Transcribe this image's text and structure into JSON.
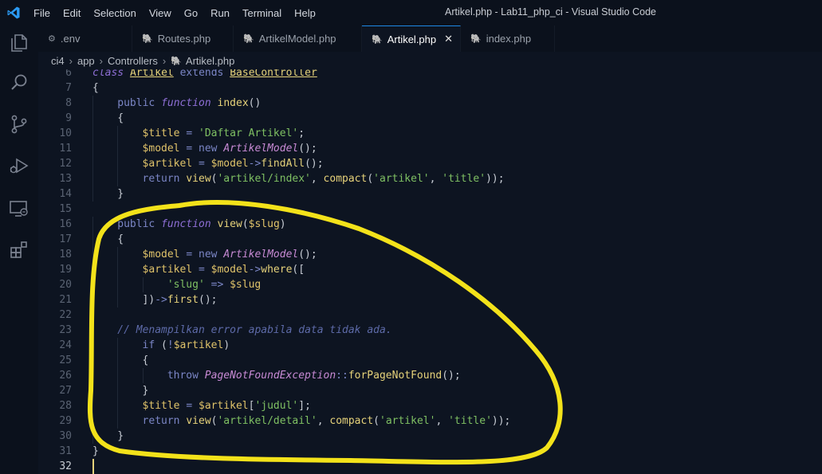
{
  "titlebar": {
    "menu": [
      "File",
      "Edit",
      "Selection",
      "View",
      "Go",
      "Run",
      "Terminal",
      "Help"
    ],
    "window_title": "Artikel.php - Lab11_php_ci - Visual Studio Code"
  },
  "activity_icons": [
    "explorer-icon",
    "search-icon",
    "source-control-icon",
    "run-debug-icon",
    "remote-explorer-icon",
    "extensions-icon"
  ],
  "tabs": [
    {
      "label": ".env",
      "icon": "gear-icon"
    },
    {
      "label": "Routes.php",
      "icon": "php-icon"
    },
    {
      "label": "ArtikelModel.php",
      "icon": "php-icon"
    },
    {
      "label": "Artikel.php",
      "icon": "php-icon",
      "active": true
    },
    {
      "label": "index.php",
      "icon": "php-icon"
    }
  ],
  "breadcrumb": [
    "ci4",
    "app",
    "Controllers",
    "Artikel.php"
  ],
  "editor": {
    "current_line": 32,
    "lines": [
      {
        "n": "6",
        "indent": 0,
        "t": [
          [
            "kf",
            "class"
          ],
          [
            "p",
            " "
          ],
          [
            "cls",
            "Artikel"
          ],
          [
            "p",
            " "
          ],
          [
            "op",
            "extends"
          ],
          [
            "p",
            " "
          ],
          [
            "cls",
            "BaseController"
          ]
        ]
      },
      {
        "n": "7",
        "indent": 0,
        "t": [
          [
            "p",
            "{"
          ]
        ]
      },
      {
        "n": "8",
        "indent": 1,
        "t": [
          [
            "k",
            "public"
          ],
          [
            "p",
            " "
          ],
          [
            "kf",
            "function"
          ],
          [
            "p",
            " "
          ],
          [
            "fn",
            "index"
          ],
          [
            "p",
            "()"
          ]
        ]
      },
      {
        "n": "9",
        "indent": 1,
        "t": [
          [
            "p",
            "{"
          ]
        ]
      },
      {
        "n": "10",
        "indent": 2,
        "t": [
          [
            "var",
            "$title"
          ],
          [
            "p",
            " "
          ],
          [
            "op",
            "="
          ],
          [
            "p",
            " "
          ],
          [
            "str",
            "'Daftar Artikel'"
          ],
          [
            "p",
            ";"
          ]
        ]
      },
      {
        "n": "11",
        "indent": 2,
        "t": [
          [
            "var",
            "$model"
          ],
          [
            "p",
            " "
          ],
          [
            "op",
            "="
          ],
          [
            "p",
            " "
          ],
          [
            "op",
            "new"
          ],
          [
            "p",
            " "
          ],
          [
            "cli",
            "ArtikelModel"
          ],
          [
            "p",
            "();"
          ]
        ]
      },
      {
        "n": "12",
        "indent": 2,
        "t": [
          [
            "var",
            "$artikel"
          ],
          [
            "p",
            " "
          ],
          [
            "op",
            "="
          ],
          [
            "p",
            " "
          ],
          [
            "var",
            "$model"
          ],
          [
            "op",
            "->"
          ],
          [
            "fn",
            "findAll"
          ],
          [
            "p",
            "();"
          ]
        ]
      },
      {
        "n": "13",
        "indent": 2,
        "t": [
          [
            "k",
            "return"
          ],
          [
            "p",
            " "
          ],
          [
            "fn",
            "view"
          ],
          [
            "p",
            "("
          ],
          [
            "str",
            "'artikel/index'"
          ],
          [
            "p",
            ", "
          ],
          [
            "fn",
            "compact"
          ],
          [
            "p",
            "("
          ],
          [
            "str",
            "'artikel'"
          ],
          [
            "p",
            ", "
          ],
          [
            "str",
            "'title'"
          ],
          [
            "p",
            "));"
          ]
        ]
      },
      {
        "n": "14",
        "indent": 1,
        "t": [
          [
            "p",
            "}"
          ]
        ]
      },
      {
        "n": "15",
        "indent": 0,
        "t": []
      },
      {
        "n": "16",
        "indent": 1,
        "t": [
          [
            "k",
            "public"
          ],
          [
            "p",
            " "
          ],
          [
            "kf",
            "function"
          ],
          [
            "p",
            " "
          ],
          [
            "fn",
            "view"
          ],
          [
            "p",
            "("
          ],
          [
            "var",
            "$slug"
          ],
          [
            "p",
            ")"
          ]
        ]
      },
      {
        "n": "17",
        "indent": 1,
        "t": [
          [
            "p",
            "{"
          ]
        ]
      },
      {
        "n": "18",
        "indent": 2,
        "t": [
          [
            "var",
            "$model"
          ],
          [
            "p",
            " "
          ],
          [
            "op",
            "="
          ],
          [
            "p",
            " "
          ],
          [
            "op",
            "new"
          ],
          [
            "p",
            " "
          ],
          [
            "cli",
            "ArtikelModel"
          ],
          [
            "p",
            "();"
          ]
        ]
      },
      {
        "n": "19",
        "indent": 2,
        "t": [
          [
            "var",
            "$artikel"
          ],
          [
            "p",
            " "
          ],
          [
            "op",
            "="
          ],
          [
            "p",
            " "
          ],
          [
            "var",
            "$model"
          ],
          [
            "op",
            "->"
          ],
          [
            "fn",
            "where"
          ],
          [
            "p",
            "(["
          ]
        ]
      },
      {
        "n": "20",
        "indent": 3,
        "t": [
          [
            "str",
            "'slug'"
          ],
          [
            "p",
            " "
          ],
          [
            "op",
            "=>"
          ],
          [
            "p",
            " "
          ],
          [
            "var",
            "$slug"
          ]
        ]
      },
      {
        "n": "21",
        "indent": 2,
        "t": [
          [
            "p",
            "])"
          ],
          [
            "op",
            "->"
          ],
          [
            "fn",
            "first"
          ],
          [
            "p",
            "();"
          ]
        ]
      },
      {
        "n": "22",
        "indent": 0,
        "t": []
      },
      {
        "n": "23",
        "indent": 1,
        "t": [
          [
            "cm",
            "// Menampilkan error apabila data tidak ada."
          ]
        ]
      },
      {
        "n": "24",
        "indent": 2,
        "t": [
          [
            "k",
            "if"
          ],
          [
            "p",
            " ("
          ],
          [
            "op",
            "!"
          ],
          [
            "var",
            "$artikel"
          ],
          [
            "p",
            ")"
          ]
        ]
      },
      {
        "n": "25",
        "indent": 2,
        "t": [
          [
            "p",
            "{"
          ]
        ]
      },
      {
        "n": "26",
        "indent": 3,
        "t": [
          [
            "k",
            "throw"
          ],
          [
            "p",
            " "
          ],
          [
            "cli",
            "PageNotFoundException"
          ],
          [
            "op",
            "::"
          ],
          [
            "fn",
            "forPageNotFound"
          ],
          [
            "p",
            "();"
          ]
        ]
      },
      {
        "n": "27",
        "indent": 2,
        "t": [
          [
            "p",
            "}"
          ]
        ]
      },
      {
        "n": "28",
        "indent": 2,
        "t": [
          [
            "var",
            "$title"
          ],
          [
            "p",
            " "
          ],
          [
            "op",
            "="
          ],
          [
            "p",
            " "
          ],
          [
            "var",
            "$artikel"
          ],
          [
            "p",
            "["
          ],
          [
            "str",
            "'judul'"
          ],
          [
            "p",
            "];"
          ]
        ]
      },
      {
        "n": "29",
        "indent": 2,
        "t": [
          [
            "k",
            "return"
          ],
          [
            "p",
            " "
          ],
          [
            "fn",
            "view"
          ],
          [
            "p",
            "("
          ],
          [
            "str",
            "'artikel/detail'"
          ],
          [
            "p",
            ", "
          ],
          [
            "fn",
            "compact"
          ],
          [
            "p",
            "("
          ],
          [
            "str",
            "'artikel'"
          ],
          [
            "p",
            ", "
          ],
          [
            "str",
            "'title'"
          ],
          [
            "p",
            "));"
          ]
        ]
      },
      {
        "n": "30",
        "indent": 1,
        "t": [
          [
            "p",
            "}"
          ]
        ]
      },
      {
        "n": "31",
        "indent": 0,
        "t": [
          [
            "p",
            "}"
          ]
        ]
      },
      {
        "n": "32",
        "indent": 0,
        "t": []
      }
    ]
  },
  "annotation_color": "#f3e21a"
}
